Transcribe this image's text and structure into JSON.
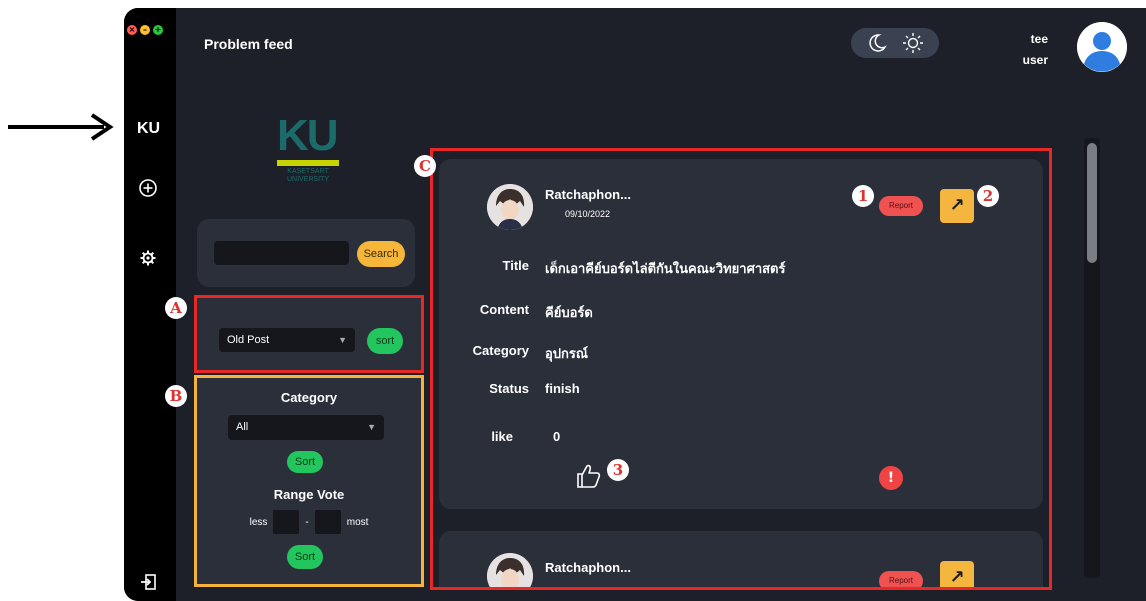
{
  "window": {
    "title": "Problem feed",
    "controls": [
      "close",
      "minimize",
      "maximize"
    ]
  },
  "sidebar": {
    "logo_text": "KU",
    "icons": [
      "add-icon",
      "gear-icon",
      "logout-icon"
    ]
  },
  "header": {
    "theme_toggle": {
      "dark_icon": "moon-icon",
      "light_icon": "sun-icon"
    },
    "user_name": "tee",
    "user_role": "user"
  },
  "brand": {
    "letters": "KU",
    "line1": "KASETSART",
    "line2": "UNIVERSITY"
  },
  "search": {
    "placeholder": "",
    "button_label": "Search"
  },
  "sort_panel": {
    "badge": "A",
    "selected_option": "Old Post",
    "button_label": "sort"
  },
  "filter_panel": {
    "badge": "B",
    "category_heading": "Category",
    "category_selected": "All",
    "category_button": "Sort",
    "range_heading": "Range Vote",
    "range_min_label": "less",
    "range_separator": "-",
    "range_max_label": "most",
    "range_button": "Sort"
  },
  "feed": {
    "badge": "C",
    "posts": [
      {
        "author": "Ratchaphon...",
        "date": "09/10/2022",
        "report_label": "Report",
        "share_icon": "arrow-up-right-icon",
        "fields": [
          {
            "label": "Title",
            "value": "เด็กเอาคีย์บอร์ดไล่ตีกันในคณะวิทยาศาสตร์"
          },
          {
            "label": "Content",
            "value": "คีย์บอร์ด"
          },
          {
            "label": "Category",
            "value": "อุปกรณ์"
          },
          {
            "label": "Status",
            "value": "finish"
          }
        ],
        "like_label": "like",
        "like_count": "0"
      },
      {
        "author": "Ratchaphon...",
        "report_label": "Report"
      }
    ]
  },
  "annotations": {
    "badge_1": "1",
    "badge_2": "2",
    "badge_3": "3"
  },
  "colors": {
    "app_bg": "#1d2028",
    "panel_bg": "#2b2f3a",
    "accent_green": "#22c55e",
    "accent_yellow": "#f4b63e",
    "accent_red": "#f05252",
    "highlight_red": "#e82727",
    "highlight_orange": "#f4b23e"
  }
}
